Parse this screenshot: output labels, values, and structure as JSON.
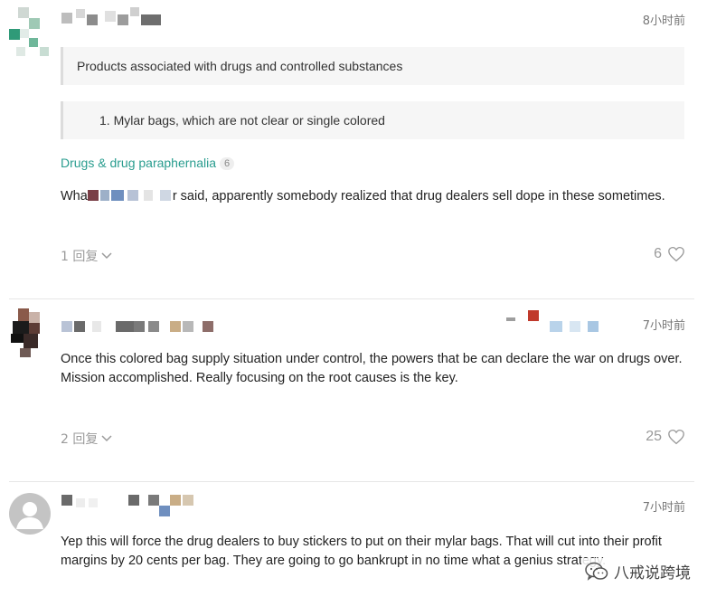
{
  "comments": [
    {
      "time": "8小时前",
      "quotes": [
        "Products associated with drugs and controlled substances",
        "1. Mylar bags, which are not clear or single colored"
      ],
      "tag": {
        "label": "Drugs & drug paraphernalia",
        "count": "6"
      },
      "text_prefix": "Wha",
      "text_suffix": "r said, apparently somebody realized that drug dealers sell dope in these sometimes.",
      "replies": "1 回复",
      "likes": "6"
    },
    {
      "time": "7小时前",
      "text": "Once this colored bag supply situation under control, the powers that be can declare the war on drugs over. Mission accomplished. Really focusing on the root causes is the key.",
      "replies": "2 回复",
      "likes": "25"
    },
    {
      "time": "7小时前",
      "text": "Yep this will force the drug dealers to buy stickers to put on their mylar bags. That will cut into their profit margins by 20 cents per bag. They are going to go bankrupt in no time what a genius strategy."
    }
  ],
  "watermark": {
    "label": "八戒说跨境",
    "icon": "wechat-icon"
  },
  "colors": {
    "tag": "#2a9d8f",
    "meta": "#9a9a9a",
    "divider": "#e6e6e6"
  }
}
